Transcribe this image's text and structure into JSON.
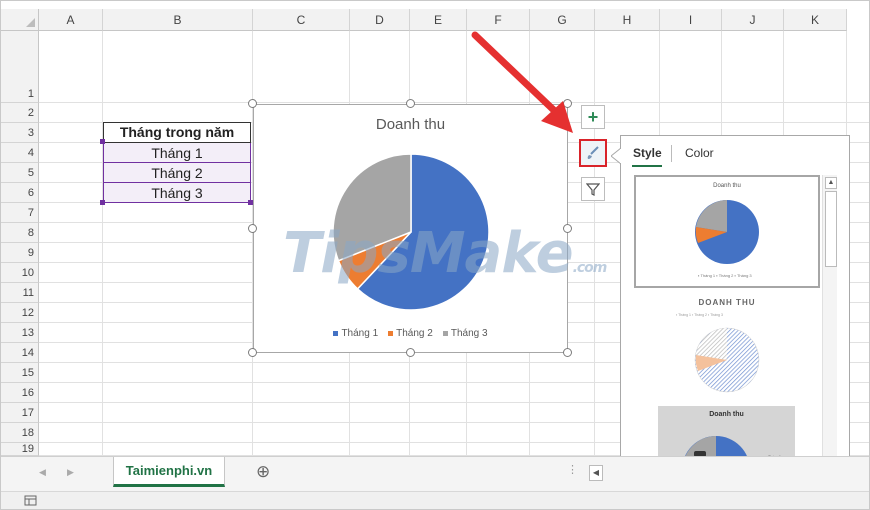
{
  "columns": [
    "A",
    "B",
    "C",
    "D",
    "E",
    "F",
    "G",
    "H",
    "I",
    "J",
    "K"
  ],
  "rows": [
    "1",
    "2",
    "3",
    "4",
    "5",
    "6",
    "7",
    "8",
    "9",
    "10",
    "11",
    "12",
    "13",
    "14",
    "15",
    "16",
    "17",
    "18",
    "19"
  ],
  "table": {
    "header": "Tháng trong năm",
    "items": [
      "Tháng 1",
      "Tháng 2",
      "Tháng 3"
    ]
  },
  "chart_data": {
    "type": "pie",
    "title": "Doanh thu",
    "categories": [
      "Tháng 1",
      "Tháng 2",
      "Tháng 3"
    ],
    "values": [
      62,
      7,
      31
    ],
    "colors": [
      "#4472c4",
      "#ed7d31",
      "#a5a5a5"
    ],
    "legend_position": "bottom"
  },
  "side_buttons": {
    "elements_icon": "plus-icon",
    "style_icon": "brush-icon",
    "filter_icon": "filter-icon"
  },
  "panel": {
    "tab_style": "Style",
    "tab_color": "Color",
    "thumb1_title": "Doanh thu",
    "thumb2_title": "DOANH THU",
    "thumb3_title": "Doanh thu"
  },
  "sheet": {
    "tab_name": "Taimienphi.vn",
    "add_sheet": "⊕"
  },
  "watermark": {
    "brand": "TipsMake",
    "suffix": ".com"
  },
  "colors": {
    "accent": "#217346",
    "red_arrow": "#e53030",
    "highlight": "#d9232a"
  }
}
